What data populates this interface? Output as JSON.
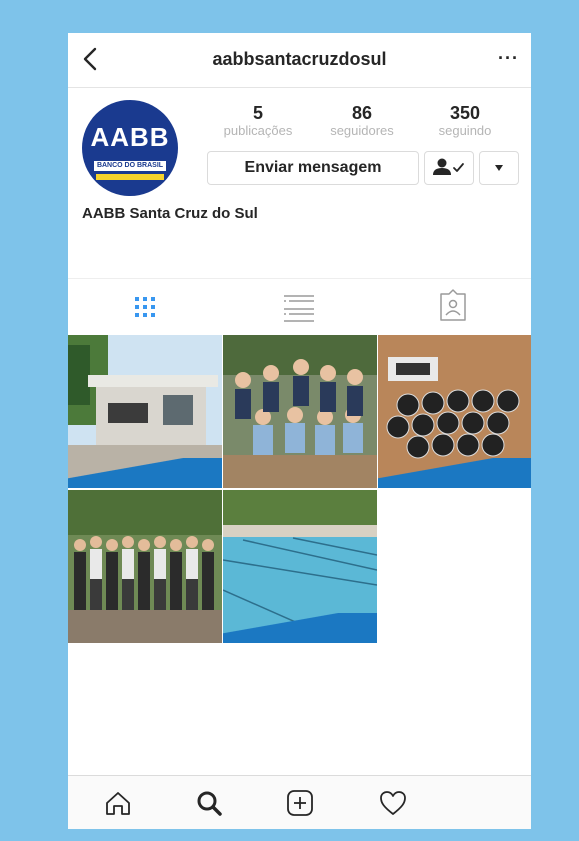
{
  "header": {
    "username": "aabbsantacruzdosul",
    "more": "···"
  },
  "profile": {
    "logo_text": "AABB",
    "logo_bank": "BANCO DO BRASIL",
    "stats": [
      {
        "value": "5",
        "label": "publicações"
      },
      {
        "value": "86",
        "label": "seguidores"
      },
      {
        "value": "350",
        "label": "seguindo"
      }
    ],
    "message_button": "Enviar mensagem",
    "full_name": "AABB Santa Cruz do Sul"
  },
  "tabs": [
    {
      "icon": "grid-icon",
      "active": true
    },
    {
      "icon": "list-icon",
      "active": false
    },
    {
      "icon": "tagged-icon",
      "active": false
    }
  ],
  "posts": [
    {
      "scene": "building-entrance"
    },
    {
      "scene": "group-photo"
    },
    {
      "scene": "trophies-table"
    },
    {
      "scene": "team-photo"
    },
    {
      "scene": "swimming-pool"
    }
  ],
  "colors": {
    "accent": "#3897f0",
    "background": "#7ec3ea",
    "brand_blue": "#1a3a8f",
    "brand_yellow": "#f6d32c"
  },
  "bottom_nav": [
    {
      "icon": "home-icon"
    },
    {
      "icon": "search-icon"
    },
    {
      "icon": "add-post-icon"
    },
    {
      "icon": "heart-icon"
    }
  ]
}
